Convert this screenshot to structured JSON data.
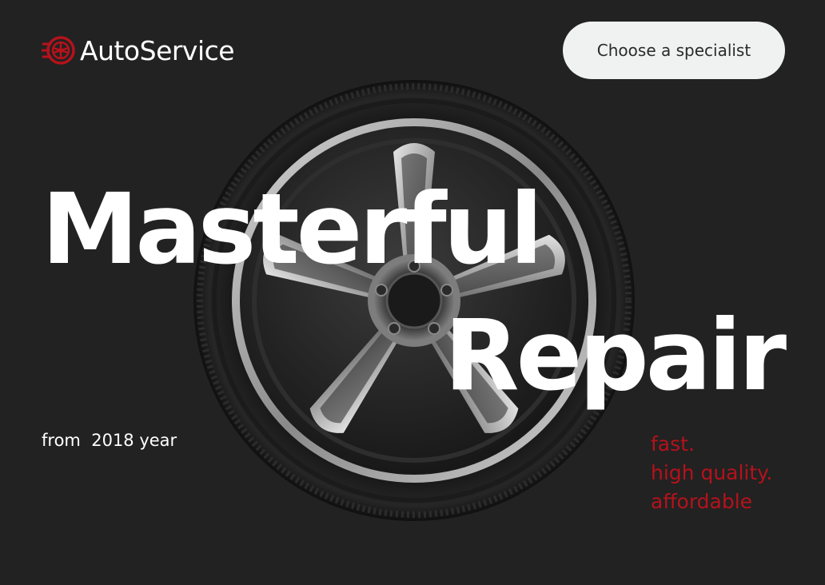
{
  "header": {
    "logo_text": "AutoService",
    "cta_label": "Choose a specialist"
  },
  "hero": {
    "headline_line1": "Masterful",
    "headline_line2": "Repair",
    "since_text": "from  2018 year",
    "tagline": [
      "fast.",
      "high quality.",
      "affordable"
    ]
  },
  "icons": {
    "logo": "wheel-icon",
    "hero_image": "car-wheel"
  },
  "colors": {
    "background": "#222222",
    "accent": "#b5121b",
    "button_bg": "#f0f2f2",
    "text_primary": "#ffffff"
  }
}
